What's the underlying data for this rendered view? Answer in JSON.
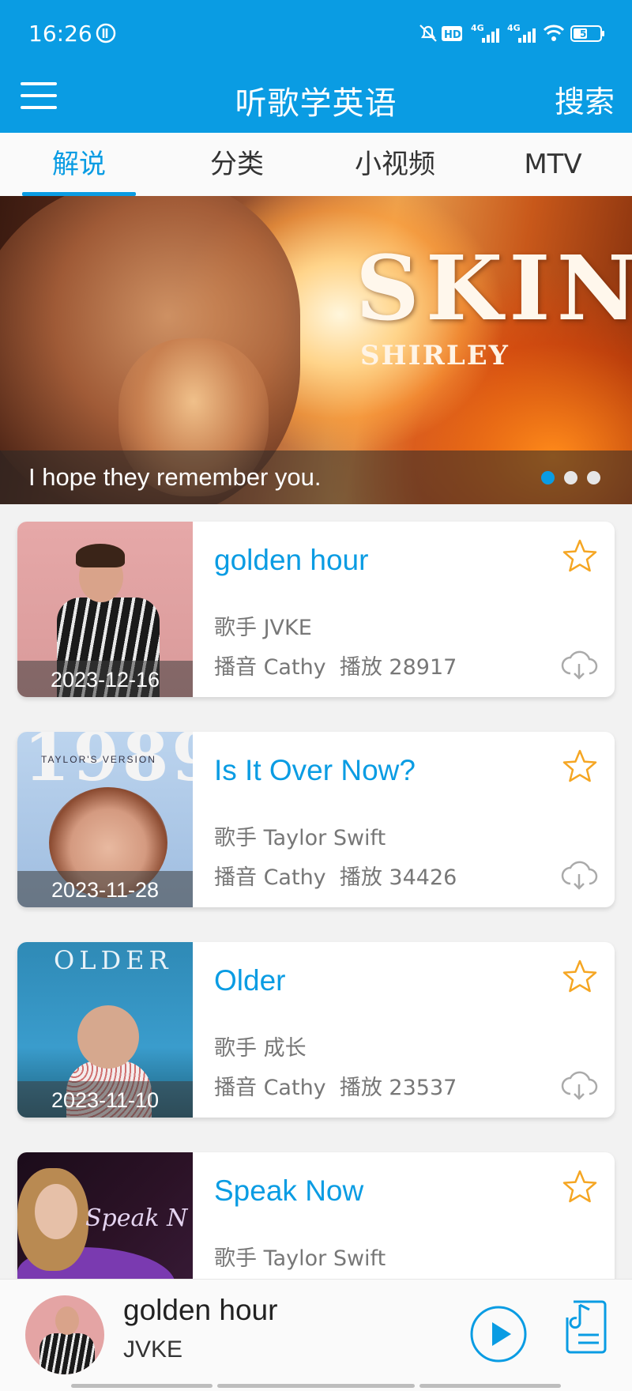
{
  "status_bar": {
    "time": "16:26",
    "battery": "51",
    "network_1": "4G",
    "network_2": "4G",
    "hd": "HD"
  },
  "app_bar": {
    "title": "听歌学英语",
    "search_label": "搜索"
  },
  "tabs": [
    {
      "label": "解说",
      "active": true
    },
    {
      "label": "分类",
      "active": false
    },
    {
      "label": "小视频",
      "active": false
    },
    {
      "label": "MTV",
      "active": false
    }
  ],
  "banner": {
    "art_title": "SKIN",
    "art_subtitle": "SHIRLEY",
    "caption": "I hope they remember you.",
    "slide_count": 3,
    "active_slide": 1
  },
  "songs": [
    {
      "title": "golden hour",
      "singer": "歌手 JVKE",
      "announcer": "播音 Cathy",
      "plays": "播放 28917",
      "date": "2023-12-16",
      "icon_star": "star-outline-icon",
      "icon_download": "cloud-download-icon"
    },
    {
      "title": "Is It Over Now?",
      "singer": "歌手 Taylor Swift",
      "announcer": "播音 Cathy",
      "plays": "播放 34426",
      "date": "2023-11-28",
      "art_text": "1989",
      "art_subtext": "TAYLOR'S VERSION"
    },
    {
      "title": "Older",
      "singer": "歌手 成长",
      "announcer": "播音 Cathy",
      "plays": "播放 23537",
      "date": "2023-11-10",
      "art_text": "OLDER"
    },
    {
      "title": "Speak Now",
      "singer": "歌手 Taylor Swift",
      "art_text": "Speak N"
    }
  ],
  "player": {
    "title": "golden hour",
    "artist": "JVKE"
  },
  "colors": {
    "accent": "#0a9ce3",
    "star": "#f5a623"
  }
}
